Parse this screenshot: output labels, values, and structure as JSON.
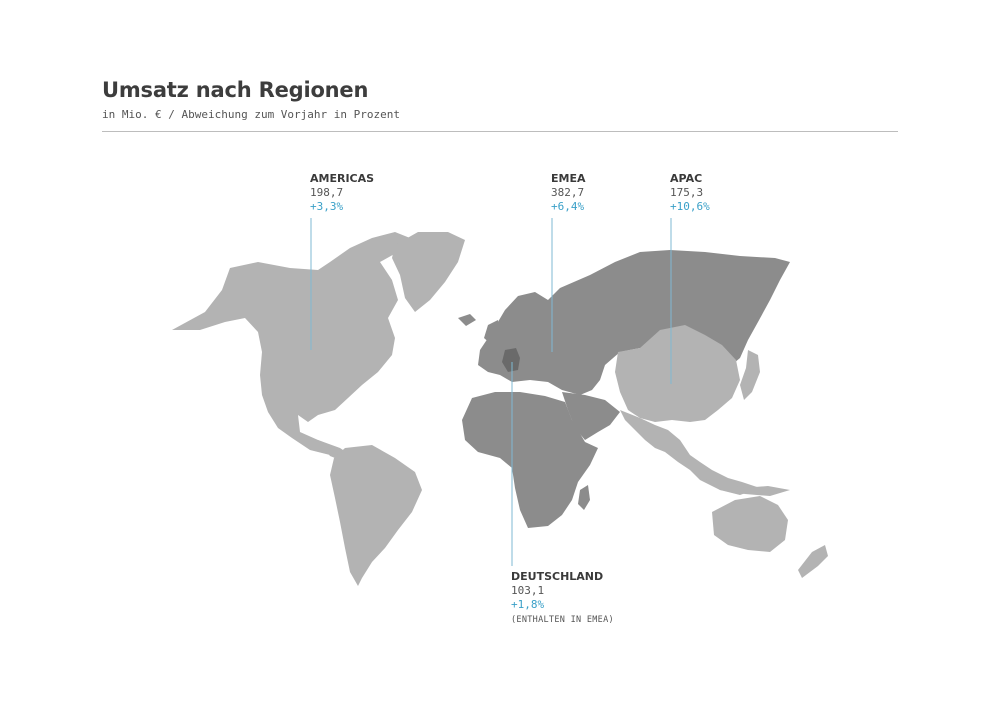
{
  "header": {
    "title": "Umsatz nach Regionen",
    "subtitle": "in Mio. € / Abweichung zum Vorjahr in Prozent"
  },
  "colors": {
    "americas_fill": "#b3b3b3",
    "emea_fill": "#8c8c8c",
    "apac_fill": "#8c8c8c",
    "china_fill": "#b3b3b3",
    "germany_fill": "#6a6a6a",
    "accent": "#3aa0c8",
    "leader_line": "#7fb9d3"
  },
  "regions": {
    "americas": {
      "name": "AMERICAS",
      "value": "198,7",
      "change": "+3,3%"
    },
    "emea": {
      "name": "EMEA",
      "value": "382,7",
      "change": "+6,4%"
    },
    "apac": {
      "name": "APAC",
      "value": "175,3",
      "change": "+10,6%"
    },
    "germany": {
      "name": "DEUTSCHLAND",
      "value": "103,1",
      "change": "+1,8%",
      "note": "(ENTHALTEN IN EMEA)"
    }
  }
}
